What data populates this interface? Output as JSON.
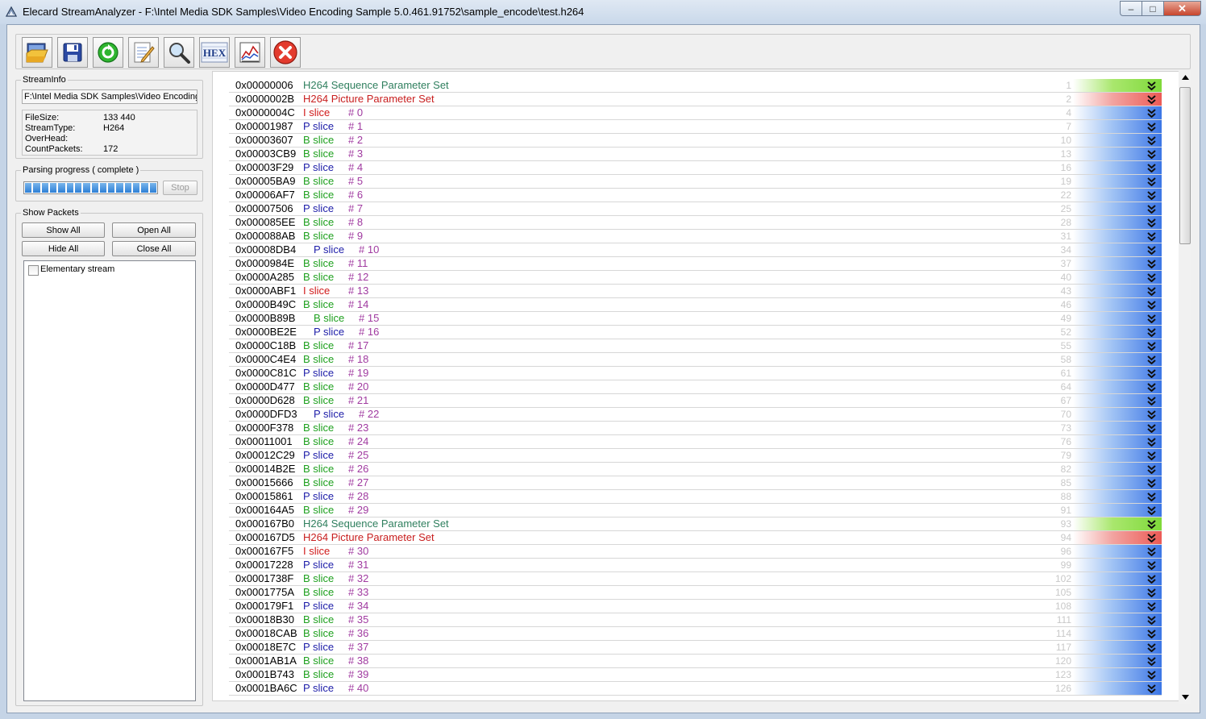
{
  "window": {
    "title": "Elecard StreamAnalyzer - F:\\Intel Media SDK Samples\\Video Encoding Sample 5.0.461.91752\\sample_encode\\test.h264",
    "min_label": "–",
    "max_label": "□",
    "close_label": "✕"
  },
  "toolbar": {
    "buttons": [
      {
        "name": "open-file-button",
        "icon": "open-folder-icon"
      },
      {
        "name": "save-button",
        "icon": "floppy-disk-icon"
      },
      {
        "name": "refresh-button",
        "icon": "green-refresh-icon"
      },
      {
        "name": "edit-button",
        "icon": "notepad-pencil-icon"
      },
      {
        "name": "search-button",
        "icon": "magnifier-icon"
      },
      {
        "name": "hex-view-button",
        "icon": "hex-icon",
        "label": "HEX"
      },
      {
        "name": "chart-button",
        "icon": "chart-icon"
      },
      {
        "name": "stop-close-button",
        "icon": "red-x-icon"
      }
    ]
  },
  "stream_info": {
    "title": "StreamInfo",
    "path": "F:\\Intel Media SDK Samples\\Video Encoding S",
    "rows": [
      {
        "key": "FileSize:",
        "value": "133 440"
      },
      {
        "key": "StreamType:",
        "value": "H264"
      },
      {
        "key": "OverHead:",
        "value": ""
      },
      {
        "key": "CountPackets:",
        "value": "172"
      }
    ]
  },
  "parsing": {
    "title": "Parsing progress ( complete )",
    "progress_percent": 100,
    "stop_label": "Stop"
  },
  "show_packets": {
    "title": "Show Packets",
    "show_all": "Show All",
    "open_all": "Open All",
    "hide_all": "Hide All",
    "close_all": "Close All",
    "tree_item": "Elementary stream"
  },
  "colors": {
    "sps": "#2f7f5e",
    "pps": "#c81e1e",
    "islice": "#d01a1a",
    "pslice": "#1c1ca8",
    "bslice": "#1ea01e",
    "number": "#a03aa0"
  },
  "packets": [
    {
      "addr": "0x00000006",
      "kind": "sps",
      "label": "H264 Sequence Parameter Set",
      "num": "",
      "idx": "1"
    },
    {
      "addr": "0x0000002B",
      "kind": "pps",
      "label": "H264 Picture Parameter Set",
      "num": "",
      "idx": "2"
    },
    {
      "addr": "0x0000004C",
      "kind": "I",
      "label": "I  slice",
      "num": "# 0",
      "idx": "4"
    },
    {
      "addr": "0x00001987",
      "kind": "P",
      "label": "P slice",
      "num": "# 1",
      "idx": "7"
    },
    {
      "addr": "0x00003607",
      "kind": "B",
      "label": "B slice",
      "num": "# 2",
      "idx": "10"
    },
    {
      "addr": "0x00003CB9",
      "kind": "B",
      "label": "B slice",
      "num": "# 3",
      "idx": "13"
    },
    {
      "addr": "0x00003F29",
      "kind": "P",
      "label": "P slice",
      "num": "# 4",
      "idx": "16"
    },
    {
      "addr": "0x00005BA9",
      "kind": "B",
      "label": "B slice",
      "num": "# 5",
      "idx": "19"
    },
    {
      "addr": "0x00006AF7",
      "kind": "B",
      "label": "B slice",
      "num": "# 6",
      "idx": "22"
    },
    {
      "addr": "0x00007506",
      "kind": "P",
      "label": "P slice",
      "num": "# 7",
      "idx": "25"
    },
    {
      "addr": "0x000085EE",
      "kind": "B",
      "label": "B slice",
      "num": "# 8",
      "idx": "28"
    },
    {
      "addr": "0x000088AB",
      "kind": "B",
      "label": "B slice",
      "num": "# 9",
      "idx": "31"
    },
    {
      "addr": "0x00008DB4",
      "kind": "P",
      "label": "P slice",
      "num": "# 10",
      "idx": "34",
      "wide": true
    },
    {
      "addr": "0x0000984E",
      "kind": "B",
      "label": "B slice",
      "num": "# 11",
      "idx": "37"
    },
    {
      "addr": "0x0000A285",
      "kind": "B",
      "label": "B slice",
      "num": "# 12",
      "idx": "40"
    },
    {
      "addr": "0x0000ABF1",
      "kind": "I",
      "label": "I  slice",
      "num": "# 13",
      "idx": "43"
    },
    {
      "addr": "0x0000B49C",
      "kind": "B",
      "label": "B slice",
      "num": "# 14",
      "idx": "46"
    },
    {
      "addr": "0x0000B89B",
      "kind": "B",
      "label": "B slice",
      "num": "# 15",
      "idx": "49",
      "wide": true
    },
    {
      "addr": "0x0000BE2E",
      "kind": "P",
      "label": "P slice",
      "num": "# 16",
      "idx": "52",
      "wide": true
    },
    {
      "addr": "0x0000C18B",
      "kind": "B",
      "label": "B slice",
      "num": "# 17",
      "idx": "55"
    },
    {
      "addr": "0x0000C4E4",
      "kind": "B",
      "label": "B slice",
      "num": "# 18",
      "idx": "58"
    },
    {
      "addr": "0x0000C81C",
      "kind": "P",
      "label": "P slice",
      "num": "# 19",
      "idx": "61"
    },
    {
      "addr": "0x0000D477",
      "kind": "B",
      "label": "B slice",
      "num": "# 20",
      "idx": "64"
    },
    {
      "addr": "0x0000D628",
      "kind": "B",
      "label": "B slice",
      "num": "# 21",
      "idx": "67"
    },
    {
      "addr": "0x0000DFD3",
      "kind": "P",
      "label": "P slice",
      "num": "# 22",
      "idx": "70",
      "wide": true
    },
    {
      "addr": "0x0000F378",
      "kind": "B",
      "label": "B slice",
      "num": "# 23",
      "idx": "73"
    },
    {
      "addr": "0x00011001",
      "kind": "B",
      "label": "B slice",
      "num": "# 24",
      "idx": "76"
    },
    {
      "addr": "0x00012C29",
      "kind": "P",
      "label": "P slice",
      "num": "# 25",
      "idx": "79"
    },
    {
      "addr": "0x00014B2E",
      "kind": "B",
      "label": "B slice",
      "num": "# 26",
      "idx": "82"
    },
    {
      "addr": "0x00015666",
      "kind": "B",
      "label": "B slice",
      "num": "# 27",
      "idx": "85"
    },
    {
      "addr": "0x00015861",
      "kind": "P",
      "label": "P slice",
      "num": "# 28",
      "idx": "88"
    },
    {
      "addr": "0x000164A5",
      "kind": "B",
      "label": "B slice",
      "num": "# 29",
      "idx": "91"
    },
    {
      "addr": "0x000167B0",
      "kind": "sps",
      "label": "H264 Sequence Parameter Set",
      "num": "",
      "idx": "93"
    },
    {
      "addr": "0x000167D5",
      "kind": "pps",
      "label": "H264 Picture Parameter Set",
      "num": "",
      "idx": "94"
    },
    {
      "addr": "0x000167F5",
      "kind": "I",
      "label": "I  slice",
      "num": "# 30",
      "idx": "96"
    },
    {
      "addr": "0x00017228",
      "kind": "P",
      "label": "P slice",
      "num": "# 31",
      "idx": "99"
    },
    {
      "addr": "0x0001738F",
      "kind": "B",
      "label": "B slice",
      "num": "# 32",
      "idx": "102"
    },
    {
      "addr": "0x0001775A",
      "kind": "B",
      "label": "B slice",
      "num": "# 33",
      "idx": "105"
    },
    {
      "addr": "0x000179F1",
      "kind": "P",
      "label": "P slice",
      "num": "# 34",
      "idx": "108"
    },
    {
      "addr": "0x00018B30",
      "kind": "B",
      "label": "B slice",
      "num": "# 35",
      "idx": "111"
    },
    {
      "addr": "0x00018CAB",
      "kind": "B",
      "label": "B slice",
      "num": "# 36",
      "idx": "114"
    },
    {
      "addr": "0x00018E7C",
      "kind": "P",
      "label": "P slice",
      "num": "# 37",
      "idx": "117"
    },
    {
      "addr": "0x0001AB1A",
      "kind": "B",
      "label": "B slice",
      "num": "# 38",
      "idx": "120"
    },
    {
      "addr": "0x0001B743",
      "kind": "B",
      "label": "B slice",
      "num": "# 39",
      "idx": "123"
    },
    {
      "addr": "0x0001BA6C",
      "kind": "P",
      "label": "P slice",
      "num": "# 40",
      "idx": "126"
    }
  ]
}
